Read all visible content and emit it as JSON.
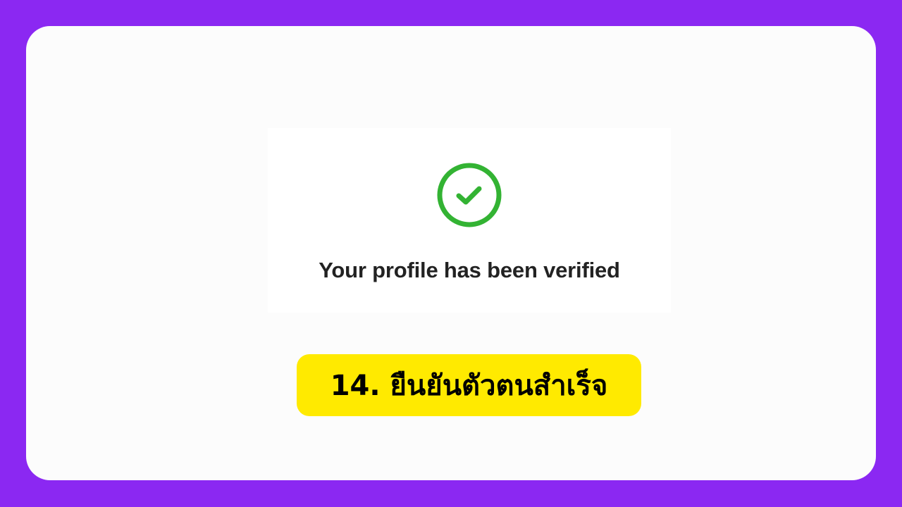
{
  "colors": {
    "frame": "#8b28f2",
    "card": "#fcfcfc",
    "success_green": "#33b333",
    "label_yellow": "#ffea00"
  },
  "screenshot": {
    "icon": "check-circle-icon",
    "message": "Your profile has been verified"
  },
  "step": {
    "label": "14. ยืนยันตัวตนสำเร็จ"
  }
}
